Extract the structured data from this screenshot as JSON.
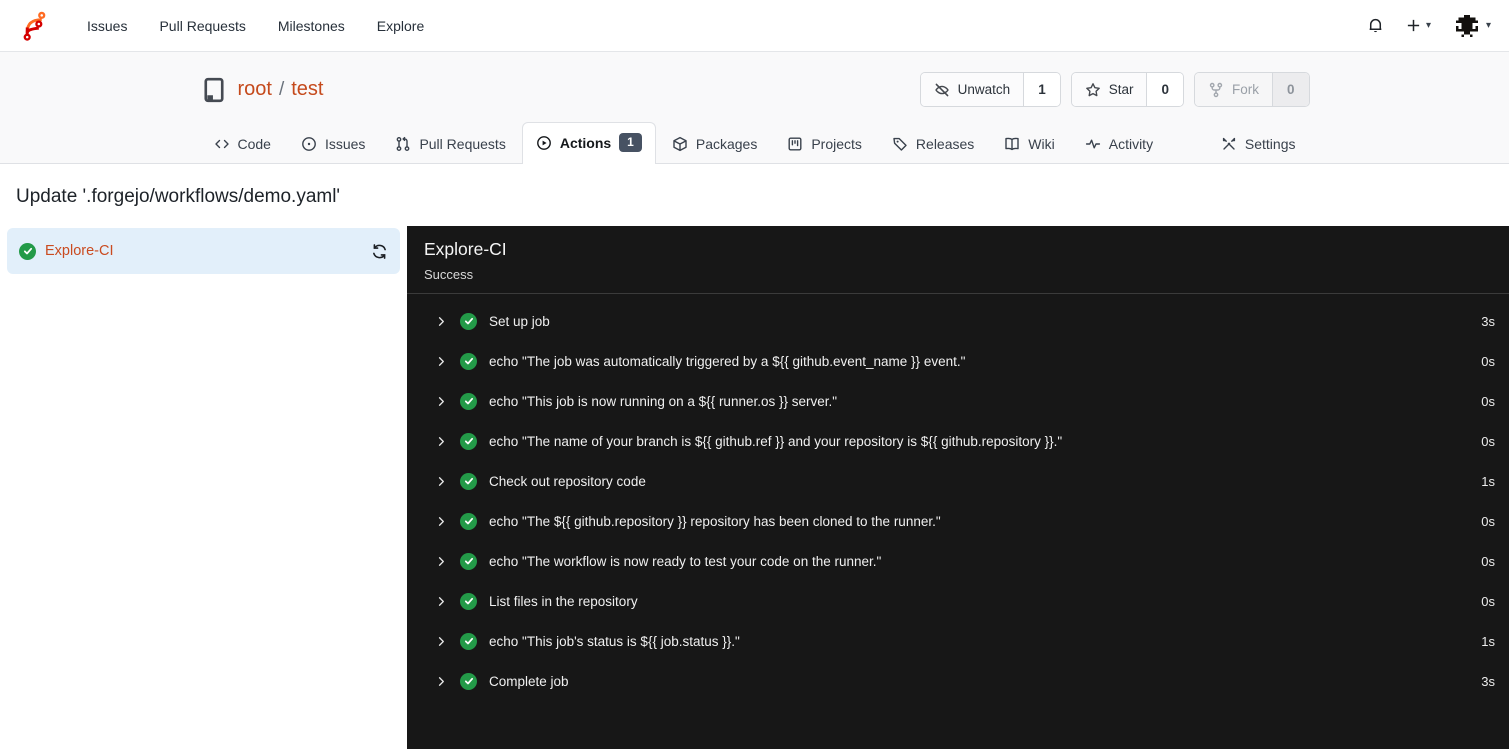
{
  "navbar": {
    "links": [
      {
        "label": "Issues"
      },
      {
        "label": "Pull Requests"
      },
      {
        "label": "Milestones"
      },
      {
        "label": "Explore"
      }
    ]
  },
  "repo": {
    "owner": "root",
    "separator": "/",
    "name": "test",
    "buttons": [
      {
        "label": "Unwatch",
        "count": "1",
        "icon": "eye-slash",
        "disabled": false
      },
      {
        "label": "Star",
        "count": "0",
        "icon": "star",
        "disabled": false
      },
      {
        "label": "Fork",
        "count": "0",
        "icon": "fork",
        "disabled": true
      }
    ],
    "tabs": [
      {
        "label": "Code",
        "icon": "code"
      },
      {
        "label": "Issues",
        "icon": "issue-circle"
      },
      {
        "label": "Pull Requests",
        "icon": "git-pull-request"
      },
      {
        "label": "Actions",
        "icon": "play-circle",
        "badge": "1",
        "active": true
      },
      {
        "label": "Packages",
        "icon": "package"
      },
      {
        "label": "Projects",
        "icon": "project-board"
      },
      {
        "label": "Releases",
        "icon": "tag"
      },
      {
        "label": "Wiki",
        "icon": "book-open"
      },
      {
        "label": "Activity",
        "icon": "pulse"
      }
    ],
    "settings_tab": {
      "label": "Settings",
      "icon": "tools"
    }
  },
  "page": {
    "title": "Update '.forgejo/workflows/demo.yaml'"
  },
  "sidebar": {
    "job": {
      "label": "Explore-CI",
      "status": "success"
    }
  },
  "panel": {
    "title": "Explore-CI",
    "status": "Success",
    "steps": [
      {
        "label": "Set up job",
        "duration": "3s"
      },
      {
        "label": "echo \"The job was automatically triggered by a ${{ github.event_name }} event.\"",
        "duration": "0s"
      },
      {
        "label": "echo \"This job is now running on a ${{ runner.os }} server.\"",
        "duration": "0s"
      },
      {
        "label": "echo \"The name of your branch is ${{ github.ref }} and your repository is ${{ github.repository }}.\"",
        "duration": "0s"
      },
      {
        "label": "Check out repository code",
        "duration": "1s"
      },
      {
        "label": "echo \"The ${{ github.repository }} repository has been cloned to the runner.\"",
        "duration": "0s"
      },
      {
        "label": "echo \"The workflow is now ready to test your code on the runner.\"",
        "duration": "0s"
      },
      {
        "label": "List files in the repository",
        "duration": "0s"
      },
      {
        "label": "echo \"This job's status is ${{ job.status }}.\"",
        "duration": "1s"
      },
      {
        "label": "Complete job",
        "duration": "3s"
      }
    ]
  },
  "colors": {
    "primary_link": "#c54a1c",
    "success_green": "#239a48",
    "panel_dark": "#171717",
    "sidebar_selected": "#e2effa",
    "badge_bg": "#475263"
  }
}
